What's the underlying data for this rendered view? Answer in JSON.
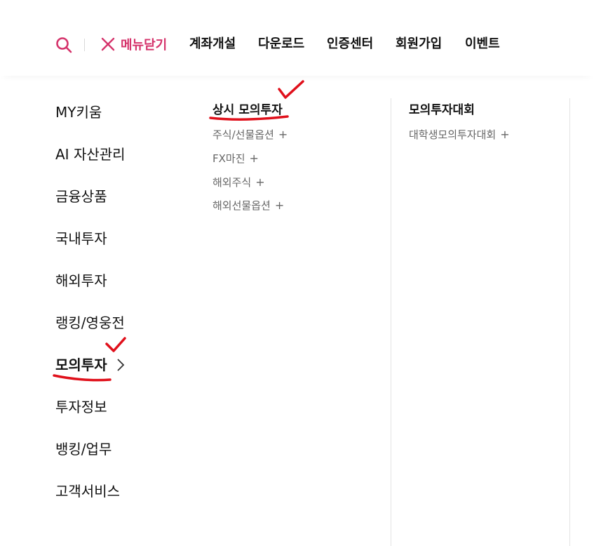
{
  "header": {
    "close_label": "메뉴닫기",
    "nav_links": [
      "계좌개설",
      "다운로드",
      "인증센터",
      "회원가입",
      "이벤트"
    ]
  },
  "sidebar": {
    "items": [
      {
        "label": "MY키움"
      },
      {
        "label": "AI 자산관리"
      },
      {
        "label": "금융상품"
      },
      {
        "label": "국내투자"
      },
      {
        "label": "해외투자"
      },
      {
        "label": "랭킹/영웅전"
      },
      {
        "label": "모의투자",
        "active": true
      },
      {
        "label": "투자정보"
      },
      {
        "label": "뱅킹/업무"
      },
      {
        "label": "고객서비스"
      }
    ]
  },
  "submenu": {
    "columns": [
      {
        "title": "상시 모의투자",
        "links": [
          {
            "label": "주식/선물옵션",
            "expand": "+"
          },
          {
            "label": "FX마진",
            "expand": "+"
          },
          {
            "label": "해외주식",
            "expand": "+"
          },
          {
            "label": "해외선물옵션",
            "expand": "+"
          }
        ]
      },
      {
        "title": "모의투자대회",
        "links": [
          {
            "label": "대학생모의투자대회",
            "expand": "+"
          }
        ]
      }
    ]
  },
  "colors": {
    "accent": "#d5336b",
    "annotation": "#e0101b",
    "text": "#111111",
    "sub_text": "#666666",
    "divider": "#e3e3e3"
  },
  "icons": {
    "search": "search-icon",
    "close": "close-icon",
    "active_indicator": "chevron-right-icon",
    "expand": "plus-icon"
  }
}
